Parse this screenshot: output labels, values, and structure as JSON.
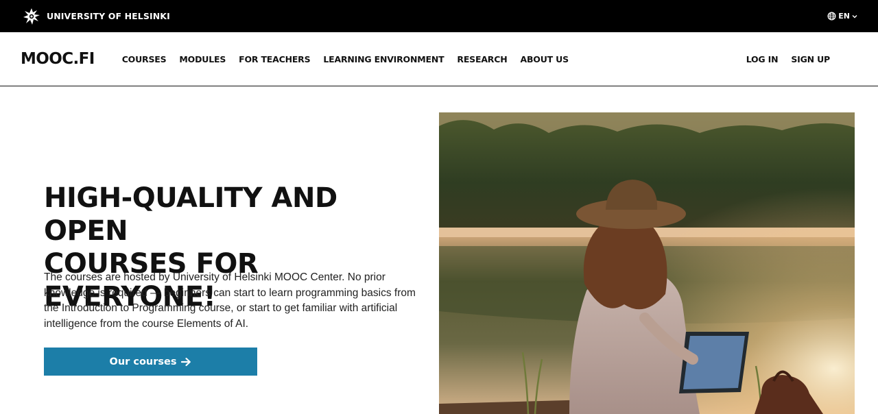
{
  "top_bar": {
    "university_name": "UNIVERSITY OF HELSINKI",
    "language": "EN",
    "icons": [
      "university-logo",
      "globe-icon",
      "chevron-down-icon"
    ]
  },
  "nav": {
    "brand": "MOOC.FI",
    "links": [
      "COURSES",
      "MODULES",
      "FOR TEACHERS",
      "LEARNING ENVIRONMENT",
      "RESEARCH",
      "ABOUT US"
    ],
    "login": "LOG IN",
    "signup": "SIGN UP"
  },
  "hero": {
    "title_line_1": "HIGH-QUALITY AND OPEN",
    "title_line_2": "COURSES FOR EVERYONE!",
    "description": "The courses are hosted by University of Helsinki MOOC Center. No prior knowledge is required — beginners can start to learn programming basics from the Introduction to Programming course, or start to get familiar with artificial intelligence from the course Elements of AI.",
    "button_label": "Our courses",
    "button_icon": "arrow-right-icon"
  },
  "colors": {
    "top_bar": "#000000",
    "button": "#1c7ea8",
    "text": "#111111"
  }
}
